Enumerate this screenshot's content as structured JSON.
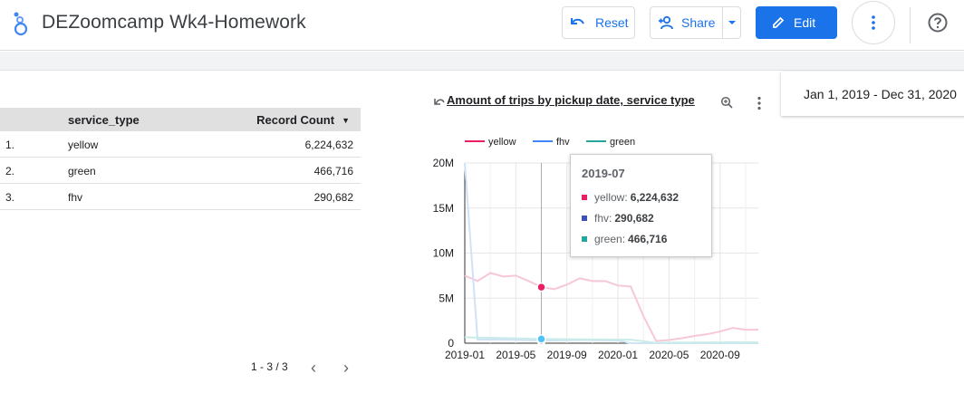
{
  "app": {
    "title": "DEZoomcamp Wk4-Homework"
  },
  "toolbar": {
    "reset_label": "Reset",
    "share_label": "Share",
    "edit_label": "Edit"
  },
  "date_range": {
    "value": "Jan 1, 2019 - Dec 31, 2020"
  },
  "table": {
    "columns": [
      "service_type",
      "Record Count"
    ],
    "rows": [
      {
        "index": "1.",
        "service_type": "yellow",
        "count": "6,224,632"
      },
      {
        "index": "2.",
        "service_type": "green",
        "count": "466,716"
      },
      {
        "index": "3.",
        "service_type": "fhv",
        "count": "290,682"
      }
    ],
    "pagination": "1 - 3 / 3"
  },
  "chart_data": {
    "type": "line",
    "title": "Amount of trips by pickup date, service type",
    "x": [
      "2019-01",
      "2019-02",
      "2019-03",
      "2019-04",
      "2019-05",
      "2019-06",
      "2019-07",
      "2019-08",
      "2019-09",
      "2019-10",
      "2019-11",
      "2019-12",
      "2020-01",
      "2020-02",
      "2020-03",
      "2020-04",
      "2020-05",
      "2020-06",
      "2020-07",
      "2020-08",
      "2020-09",
      "2020-10",
      "2020-11",
      "2020-12"
    ],
    "x_ticks": [
      "2019-01",
      "2019-05",
      "2019-09",
      "2020-01",
      "2020-05",
      "2020-09"
    ],
    "y_ticks": [
      "0",
      "5M",
      "10M",
      "15M",
      "20M"
    ],
    "ylim": [
      0,
      20000000
    ],
    "grid": true,
    "legend_position": "top",
    "highlight_category": "2019-07",
    "series": [
      {
        "name": "yellow",
        "color": "#f7c7d9",
        "legend_color": "#e91e63",
        "values": [
          7500000,
          6900000,
          7800000,
          7400000,
          7500000,
          6900000,
          6224632,
          6000000,
          6500000,
          7200000,
          6900000,
          6900000,
          6400000,
          6300000,
          3000000,
          240000,
          350000,
          550000,
          800000,
          1000000,
          1300000,
          1700000,
          1500000,
          1500000
        ]
      },
      {
        "name": "fhv",
        "color": "#cfe3f5",
        "legend_color": "#4285f4",
        "values": [
          20000000,
          400000,
          420000,
          380000,
          360000,
          330000,
          290682,
          300000,
          330000,
          350000,
          340000,
          320000,
          300000,
          0,
          0,
          0,
          0,
          0,
          0,
          0,
          0,
          0,
          0,
          0
        ]
      },
      {
        "name": "green",
        "color": "#c9ece8",
        "legend_color": "#26a69a",
        "values": [
          670000,
          620000,
          600000,
          560000,
          540000,
          490000,
          466716,
          450000,
          440000,
          430000,
          420000,
          410000,
          400000,
          390000,
          220000,
          30000,
          60000,
          70000,
          80000,
          90000,
          90000,
          100000,
          90000,
          90000
        ]
      }
    ]
  },
  "tooltip": {
    "title": "2019-07",
    "rows": [
      {
        "label": "yellow:",
        "value": "6,224,632",
        "color": "#e91e63"
      },
      {
        "label": "fhv:",
        "value": "290,682",
        "color": "#3f51b5"
      },
      {
        "label": "green:",
        "value": "466,716",
        "color": "#26a69a"
      }
    ]
  }
}
